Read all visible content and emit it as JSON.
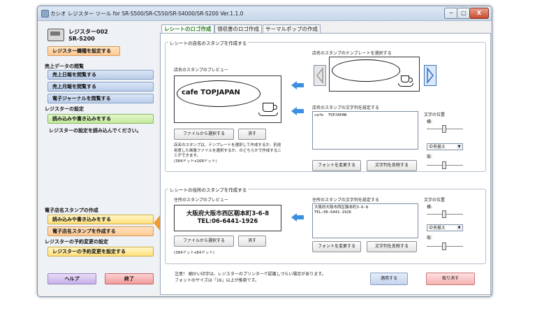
{
  "window": {
    "title": "カシオ レジスター ツール for SR-S500/SR-C550/SR-S4000/SR-S200 Ver.1.1.0",
    "controls": {
      "minimize": "─",
      "maximize": "□",
      "close": "X"
    }
  },
  "sidebar": {
    "device_name_line1": "レジスター002",
    "device_name_line2": "SR-S200",
    "set_model_button": "レジスター機種を設定する",
    "sales_section": "売上データの閲覧",
    "daily_button": "売上日報を閲覧する",
    "monthly_button": "売上月報を閲覧する",
    "journal_button": "電子ジャーナルを閲覧する",
    "settings_section": "レジスターの設定",
    "read_write_button": "読み込みや書き込みをする",
    "settings_note": "レジスターの設定を読み込んでください。",
    "stamp_section": "電子店名スタンプの作成",
    "stamp_read_write_button": "読み込みや書き込みをする",
    "stamp_create_button": "電子店名スタンプを作成する",
    "reserve_section": "レジスターの予約変更の設定",
    "reserve_button": "レジスターの予約変更を設定する",
    "help_button": "ヘルプ",
    "exit_button": "終了"
  },
  "tabs": [
    "レシートのロゴ作成",
    "領収書のロゴ作成",
    "サーマルポップの作成"
  ],
  "store_group": {
    "legend": "レシートの店名のスタンプを作成する",
    "preview_label": "店名のスタンプのプレビュー",
    "preview_text": "cafe  TOPJAPAN",
    "template_label": "店名のスタンプのテンプレートを選択する",
    "text_label": "店名のスタンプの文字列を設定する",
    "text_value": "cafe  TOPJAPAN",
    "select_file_button": "ファイルから選択する",
    "clear_button": "消す",
    "help_text": "店名のスタンプは、テンプレートを選択して作成するか、別途用意した画像ファイルを選択するか、のどちらかで作成することができます。\n(384ドットx168ドット)",
    "font_button": "フォントを変更する",
    "invert_button": "文字列を反映する",
    "position_label": "文字の位置",
    "horizontal_label": "横:",
    "align_value": "中央揃え",
    "vertical_label": "縦:",
    "horizontal_position": 0.45,
    "vertical_position": 0.45
  },
  "address_group": {
    "legend": "レシートの住所のスタンプを作成する",
    "preview_label": "住所のスタンプのプレビュー",
    "preview_line1": "大阪府大阪市西区靱本町3-6-8",
    "preview_line2": "TEL:06-6441-1926",
    "text_label": "住所のスタンプの文字列を設定する",
    "text_value": "大阪府大阪市西区靱本町3-6-8\nTEL:06-6441-1926",
    "select_file_button": "ファイルから選択する",
    "clear_button": "消す",
    "size_text": "(384ドットx84ドット)",
    "font_button": "フォントを変更する",
    "invert_button": "文字列を反映する",
    "position_label": "文字の位置",
    "horizontal_label": "横:",
    "align_value": "中央揃え",
    "vertical_label": "縦:",
    "horizontal_position": 0.45,
    "vertical_position": 0.45
  },
  "footer": {
    "note_line1": "注意！ 細かい印字は、レジスターのプリンターで認識しづらい場合があります。",
    "note_line2": "フォントのサイズは「16」以上が推奨です。",
    "apply_button": "適用する",
    "cancel_button": "取り消す"
  },
  "colors": {
    "arrow": "#3b8fe0",
    "selection_marker": "#f29a2e",
    "active_tab_text": "#2b7a1e"
  }
}
